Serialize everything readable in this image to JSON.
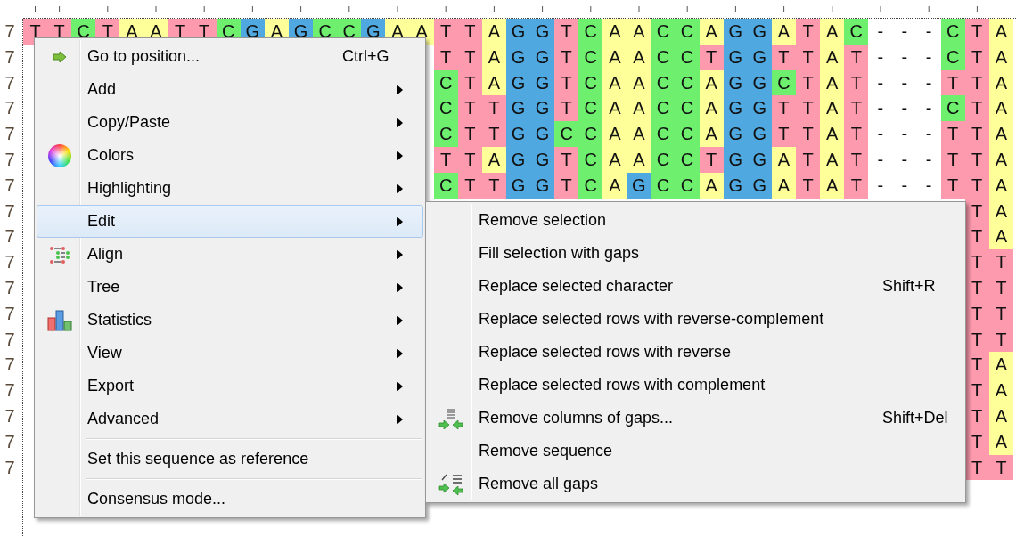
{
  "alignment": {
    "rows": [
      {
        "label": "7",
        "bases": [
          "T",
          "T",
          "C",
          "T",
          "A",
          "A",
          "T",
          "T",
          "C",
          "G",
          "A",
          "G",
          "C",
          "C",
          "G",
          "A",
          "A",
          "T",
          "T",
          "A",
          "G",
          "G",
          "T",
          "C",
          "A",
          "A",
          "C",
          "C",
          "A",
          "G",
          "G",
          "A",
          "T",
          "A",
          "C",
          "-",
          "-",
          "-",
          "C",
          "T",
          "A"
        ]
      },
      {
        "label": "7",
        "bases": [
          "T",
          "T",
          "A",
          "G",
          "G",
          "T",
          "C",
          "A",
          "A",
          "C",
          "C",
          "T",
          "G",
          "G",
          "T",
          "T",
          "A",
          "T",
          "-",
          "-",
          "-",
          "C",
          "T",
          "A"
        ]
      },
      {
        "label": "7",
        "bases": [
          "C",
          "T",
          "A",
          "G",
          "G",
          "T",
          "C",
          "A",
          "A",
          "C",
          "C",
          "A",
          "G",
          "G",
          "C",
          "T",
          "A",
          "T",
          "-",
          "-",
          "-",
          "T",
          "T",
          "A"
        ]
      },
      {
        "label": "7",
        "bases": [
          "C",
          "T",
          "T",
          "G",
          "G",
          "T",
          "C",
          "A",
          "A",
          "C",
          "C",
          "A",
          "G",
          "G",
          "T",
          "T",
          "A",
          "T",
          "-",
          "-",
          "-",
          "C",
          "T",
          "A"
        ]
      },
      {
        "label": "7",
        "bases": [
          "C",
          "T",
          "T",
          "G",
          "G",
          "C",
          "C",
          "A",
          "A",
          "C",
          "C",
          "A",
          "G",
          "G",
          "T",
          "T",
          "A",
          "T",
          "-",
          "-",
          "-",
          "T",
          "T",
          "A"
        ]
      },
      {
        "label": "7",
        "bases": [
          "T",
          "T",
          "A",
          "G",
          "G",
          "T",
          "C",
          "A",
          "A",
          "C",
          "C",
          "T",
          "G",
          "G",
          "A",
          "T",
          "A",
          "T",
          "-",
          "-",
          "-",
          "T",
          "T",
          "A"
        ]
      },
      {
        "label": "7",
        "bases": [
          "C",
          "T",
          "T",
          "G",
          "G",
          "T",
          "C",
          "A",
          "G",
          "C",
          "C",
          "A",
          "G",
          "G",
          "A",
          "T",
          "A",
          "T",
          "-",
          "-",
          "-",
          "T",
          "T",
          "A"
        ]
      },
      {
        "label": "7",
        "bases": [
          "T",
          "A"
        ]
      },
      {
        "label": "7",
        "bases": [
          "T",
          "A"
        ]
      },
      {
        "label": "7",
        "bases": [
          "T",
          "T"
        ]
      },
      {
        "label": "7",
        "bases": [
          "T",
          "T"
        ]
      },
      {
        "label": "7",
        "bases": [
          "T",
          "T"
        ]
      },
      {
        "label": "7",
        "bases": [
          "T",
          "T"
        ]
      },
      {
        "label": "7",
        "bases": [
          "T",
          "A"
        ]
      },
      {
        "label": "7",
        "bases": [
          "T",
          "A"
        ]
      },
      {
        "label": "7",
        "bases": [
          "T",
          "A"
        ]
      },
      {
        "label": "7",
        "bases": [
          "T",
          "A"
        ]
      },
      {
        "label": "7",
        "bases": [
          "T",
          "T"
        ]
      }
    ]
  },
  "context_menu": {
    "items": [
      {
        "kind": "item",
        "label": "Go to position...",
        "shortcut": "Ctrl+G",
        "submenu": false,
        "selected": false
      },
      {
        "kind": "item",
        "label": "Add",
        "submenu": true,
        "selected": false
      },
      {
        "kind": "item",
        "label": "Copy/Paste",
        "submenu": true,
        "selected": false
      },
      {
        "kind": "item",
        "label": "Colors",
        "submenu": true,
        "selected": false
      },
      {
        "kind": "item",
        "label": "Highlighting",
        "submenu": true,
        "selected": false
      },
      {
        "kind": "item",
        "label": "Edit",
        "submenu": true,
        "selected": true,
        "children": [
          {
            "label": "Remove selection"
          },
          {
            "label": "Fill selection with gaps"
          },
          {
            "label": "Replace selected character",
            "shortcut": "Shift+R"
          },
          {
            "label": "Replace selected rows with reverse-complement"
          },
          {
            "label": "Replace selected rows with reverse"
          },
          {
            "label": "Replace selected rows with complement"
          },
          {
            "label": "Remove columns of gaps...",
            "shortcut": "Shift+Del"
          },
          {
            "label": "Remove sequence"
          },
          {
            "label": "Remove all gaps"
          }
        ]
      },
      {
        "kind": "item",
        "label": "Align",
        "submenu": true,
        "selected": false
      },
      {
        "kind": "item",
        "label": "Tree",
        "submenu": true,
        "selected": false
      },
      {
        "kind": "item",
        "label": "Statistics",
        "submenu": true,
        "selected": false
      },
      {
        "kind": "item",
        "label": "View",
        "submenu": true,
        "selected": false
      },
      {
        "kind": "item",
        "label": "Export",
        "submenu": true,
        "selected": false
      },
      {
        "kind": "item",
        "label": "Advanced",
        "submenu": true,
        "selected": false
      },
      {
        "kind": "separator"
      },
      {
        "kind": "item",
        "label": "Set this sequence as reference",
        "submenu": false,
        "selected": false
      },
      {
        "kind": "separator"
      },
      {
        "kind": "item",
        "label": "Consensus mode...",
        "submenu": false,
        "selected": false
      }
    ]
  }
}
